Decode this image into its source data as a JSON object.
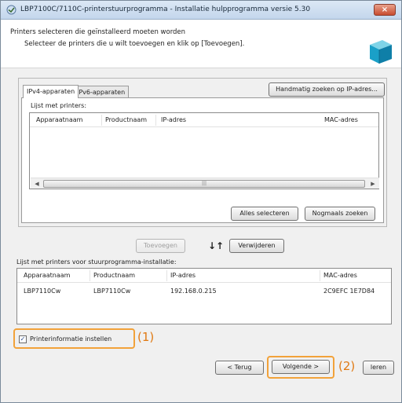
{
  "window": {
    "title": "LBP7100C/7110C-printerstuurprogramma - Installatie hulpprogramma versie 5.30",
    "close_label": "×"
  },
  "header": {
    "line1": "Printers selecteren die geïnstalleerd moeten worden",
    "line2": "Selecteer de printers die u wilt toevoegen en klik op [Toevoegen]."
  },
  "tabs": [
    {
      "label": "IPv4-apparaten",
      "active": true
    },
    {
      "label": "IPv6-apparaten",
      "active": false
    }
  ],
  "manual_search_label": "Handmatig zoeken op IP-adres...",
  "printer_list": {
    "title": "Lijst met printers:",
    "columns": [
      "Apparaatnaam",
      "Productnaam",
      "IP-adres",
      "MAC-adres"
    ],
    "rows": []
  },
  "select_all_label": "Alles selecteren",
  "search_again_label": "Nogmaals zoeken",
  "add_label": "Toevoegen",
  "transfer_arrows": "↓↑",
  "remove_label": "Verwijderen",
  "install_list": {
    "title": "Lijst met printers voor stuurprogramma-installatie:",
    "columns": [
      "Apparaatnaam",
      "Productnaam",
      "IP-adres",
      "MAC-adres"
    ],
    "rows": [
      [
        "LBP7110Cw",
        "LBP7110Cw",
        "192.168.0.215",
        "2C9EFC 1E7D84"
      ]
    ]
  },
  "printer_info_checkbox": {
    "label": "Printerinformatie instellen",
    "checked": true
  },
  "back_label": "< Terug",
  "next_label": "Volgende >",
  "cancel_label": "leren",
  "callout_1": "(1)",
  "callout_2": "(2)",
  "accent_color": "#f2a23a",
  "callout_color": "#e07a14"
}
